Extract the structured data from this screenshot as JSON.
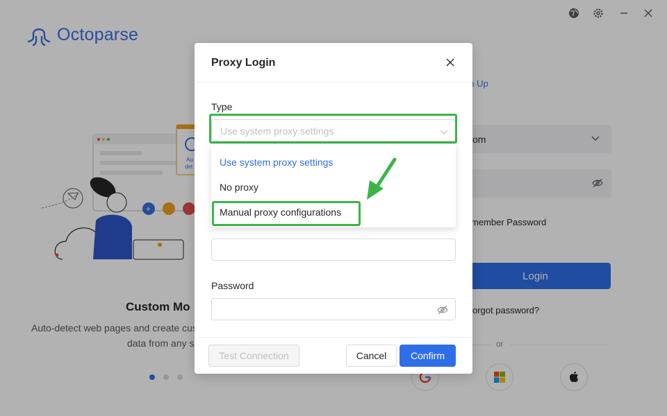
{
  "app": {
    "name": "Octoparse",
    "brand_color": "#3a6fe0",
    "signup_link": "gn Up",
    "email_fragment": "om",
    "remember_fragment": "member Password",
    "login_label": "Login",
    "forgot_fragment": "orgot password?",
    "or_text": "or",
    "slide": {
      "title": "Custom Mo",
      "desc_line1": "Auto-detect web pages and create cus",
      "desc_line2": "data from any s",
      "illustration_text": "Au det",
      "active_dot": 0
    },
    "window_icons": [
      "globe-icon",
      "gear-icon",
      "minimize-icon",
      "close-icon"
    ],
    "social_icons": [
      "google-icon",
      "microsoft-icon",
      "apple-icon"
    ]
  },
  "dialog": {
    "title": "Proxy Login",
    "type_label": "Type",
    "type_placeholder": "Use system proxy settings",
    "password_label": "Password",
    "buttons": {
      "test": "Test Connection",
      "cancel": "Cancel",
      "confirm": "Confirm"
    },
    "options": [
      {
        "label": "Use system proxy settings",
        "selected": true
      },
      {
        "label": "No proxy",
        "selected": false
      },
      {
        "label": "Manual proxy configurations",
        "selected": false
      }
    ]
  },
  "colors": {
    "primary": "#2f6ee9",
    "highlight": "#3cb449"
  }
}
